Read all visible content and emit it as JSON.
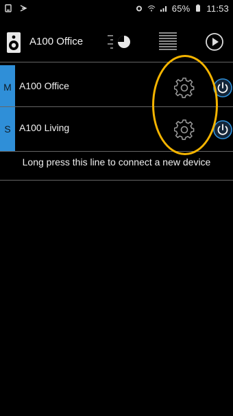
{
  "status_bar": {
    "battery": "65%",
    "time": "11:53",
    "icons": [
      "device-icon",
      "cast-icon",
      "alarm-icon",
      "wifi-icon",
      "signal-icon",
      "battery-icon"
    ]
  },
  "header": {
    "title": "A100 Office",
    "icons": [
      "speaker-icon",
      "mixer-icon",
      "list-icon",
      "play-icon"
    ]
  },
  "devices": [
    {
      "role": "M",
      "name": "A100 Office",
      "gear_icon": "gear-icon",
      "power_icon": "power-icon"
    },
    {
      "role": "S",
      "name": "A100 Living",
      "gear_icon": "gear-icon",
      "power_icon": "power-icon"
    }
  ],
  "hint": "Long press this line to connect a new device",
  "colors": {
    "accent_blue": "#2f8fd8",
    "annotation_yellow": "#f4b400",
    "divider": "#666666",
    "background": "#000000"
  }
}
